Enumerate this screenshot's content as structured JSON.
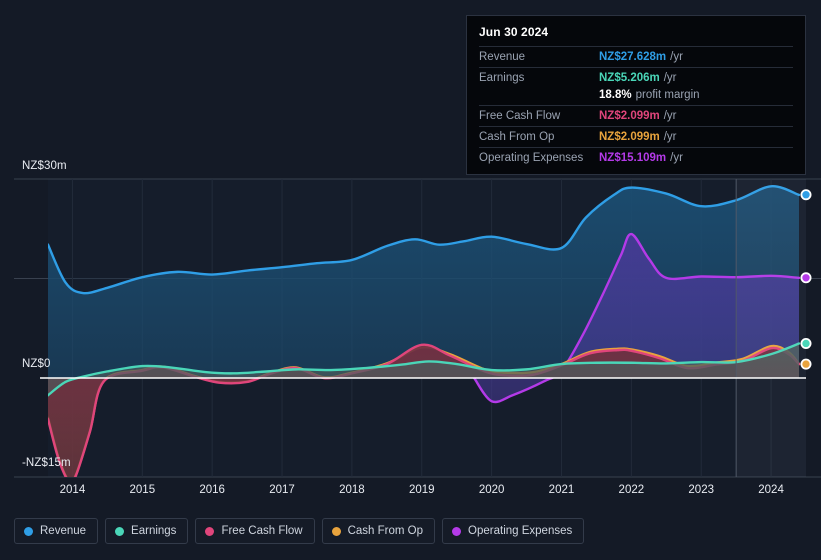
{
  "tooltip": {
    "date": "Jun 30 2024",
    "rows": [
      {
        "label": "Revenue",
        "value": "NZ$27.628m",
        "unit": "/yr",
        "color": "#2f9ee6"
      },
      {
        "label": "Earnings",
        "value": "NZ$5.206m",
        "unit": "/yr",
        "color": "#4ad6b8"
      },
      {
        "label": "",
        "value": "18.8%",
        "unit": "profit margin",
        "color": "#ffffff"
      },
      {
        "label": "Free Cash Flow",
        "value": "NZ$2.099m",
        "unit": "/yr",
        "color": "#e0457b"
      },
      {
        "label": "Cash From Op",
        "value": "NZ$2.099m",
        "unit": "/yr",
        "color": "#e8a33d"
      },
      {
        "label": "Operating Expenses",
        "value": "NZ$15.109m",
        "unit": "/yr",
        "color": "#b43ae8"
      }
    ]
  },
  "legend": {
    "items": [
      {
        "label": "Revenue",
        "color": "#2f9ee6"
      },
      {
        "label": "Earnings",
        "color": "#4ad6b8"
      },
      {
        "label": "Free Cash Flow",
        "color": "#e0457b"
      },
      {
        "label": "Cash From Op",
        "color": "#e8a33d"
      },
      {
        "label": "Operating Expenses",
        "color": "#b43ae8"
      }
    ]
  },
  "chart_data": {
    "type": "area",
    "title": "",
    "xlabel": "",
    "ylabel": "",
    "currency": "NZ$",
    "unit": "m",
    "grid": true,
    "legend_position": "bottom",
    "xlim": [
      2013.65,
      2024.5
    ],
    "ylim": [
      -16.5,
      30.2
    ],
    "y_ticks": [
      {
        "value": 30,
        "label": "NZ$30m"
      },
      {
        "value": 0,
        "label": "NZ$0"
      },
      {
        "value": -15,
        "label": "-NZ$15m"
      }
    ],
    "x_ticks": [
      {
        "value": 2014,
        "label": "2014"
      },
      {
        "value": 2015,
        "label": "2015"
      },
      {
        "value": 2016,
        "label": "2016"
      },
      {
        "value": 2017,
        "label": "2017"
      },
      {
        "value": 2018,
        "label": "2018"
      },
      {
        "value": 2019,
        "label": "2019"
      },
      {
        "value": 2020,
        "label": "2020"
      },
      {
        "value": 2021,
        "label": "2021"
      },
      {
        "value": 2022,
        "label": "2022"
      },
      {
        "value": 2023,
        "label": "2023"
      },
      {
        "value": 2024,
        "label": "2024"
      }
    ],
    "forecast_divider_x": 2023.5,
    "series": [
      {
        "name": "Revenue",
        "color": "#2f9ee6",
        "fill": "#1c4f74",
        "x": [
          2013.65,
          2013.9,
          2014.15,
          2014.5,
          2015.0,
          2015.5,
          2016.0,
          2016.5,
          2017.0,
          2017.5,
          2018.0,
          2018.5,
          2018.9,
          2019.25,
          2019.6,
          2020.0,
          2020.5,
          2021.0,
          2021.35,
          2021.75,
          2022.0,
          2022.5,
          2023.0,
          2023.5,
          2024.0,
          2024.4
        ],
        "y": [
          20.1,
          14.4,
          12.8,
          13.6,
          15.2,
          16.0,
          15.6,
          16.2,
          16.7,
          17.3,
          17.8,
          19.9,
          20.9,
          20.1,
          20.6,
          21.3,
          20.2,
          19.6,
          24.2,
          27.6,
          28.7,
          27.8,
          25.9,
          26.8,
          28.9,
          27.6
        ]
      },
      {
        "name": "Operating Expenses",
        "color": "#b43ae8",
        "fill": "#473a96",
        "x": [
          2019.75,
          2020.0,
          2020.3,
          2020.75,
          2021.0,
          2021.3,
          2021.6,
          2021.85,
          2022.0,
          2022.25,
          2022.5,
          2023.0,
          2023.5,
          2024.0,
          2024.4
        ],
        "y": [
          0.0,
          -3.5,
          -2.6,
          -0.5,
          1.1,
          6.4,
          12.8,
          18.5,
          21.7,
          18.0,
          15.1,
          15.3,
          15.2,
          15.4,
          15.1
        ]
      },
      {
        "name": "Cash From Op",
        "color": "#e8a33d",
        "fill": "#6b4f2e",
        "x": [
          2013.65,
          2013.8,
          2013.95,
          2014.05,
          2014.25,
          2014.45,
          2015.0,
          2015.3,
          2015.75,
          2016.1,
          2016.5,
          2016.85,
          2017.2,
          2017.6,
          2018.0,
          2018.5,
          2019.0,
          2019.4,
          2019.9,
          2020.2,
          2020.6,
          2021.0,
          2021.4,
          2021.8,
          2022.0,
          2022.4,
          2022.8,
          2023.2,
          2023.6,
          2024.0,
          2024.25,
          2024.4
        ],
        "y": [
          -6.0,
          -12.0,
          -15.5,
          -14.6,
          -8.0,
          -0.4,
          1.2,
          1.7,
          0.3,
          -0.6,
          -0.5,
          0.8,
          1.6,
          0.1,
          0.8,
          2.2,
          4.6,
          3.6,
          1.3,
          0.8,
          0.9,
          2.1,
          3.9,
          4.4,
          4.3,
          3.3,
          1.8,
          2.3,
          2.9,
          4.8,
          3.9,
          2.1
        ]
      },
      {
        "name": "Free Cash Flow",
        "color": "#e0457b",
        "fill": "#6e2e45",
        "x": [
          2013.65,
          2013.8,
          2013.95,
          2014.05,
          2014.25,
          2014.45,
          2015.0,
          2015.3,
          2015.75,
          2016.1,
          2016.5,
          2016.85,
          2017.2,
          2017.6,
          2018.0,
          2018.5,
          2019.0,
          2019.4,
          2019.9,
          2020.2,
          2020.6,
          2021.0,
          2021.4,
          2021.8,
          2022.0,
          2022.4,
          2022.8,
          2023.2,
          2023.6,
          2024.0,
          2024.25,
          2024.4
        ],
        "y": [
          -6.2,
          -12.2,
          -15.6,
          -14.7,
          -8.1,
          -0.5,
          1.1,
          1.6,
          0.2,
          -0.7,
          -0.6,
          0.7,
          1.5,
          0.0,
          0.7,
          2.1,
          5.0,
          3.4,
          1.0,
          0.4,
          0.5,
          1.9,
          3.7,
          4.2,
          4.1,
          3.0,
          1.5,
          2.0,
          2.6,
          4.5,
          3.6,
          2.1
        ]
      },
      {
        "name": "Earnings",
        "color": "#4ad6b8",
        "fill": "#4b5c5d",
        "x": [
          2013.65,
          2013.9,
          2014.15,
          2014.5,
          2015.0,
          2015.4,
          2015.9,
          2016.3,
          2016.8,
          2017.2,
          2017.7,
          2018.2,
          2018.7,
          2019.1,
          2019.5,
          2020.0,
          2020.5,
          2021.0,
          2021.5,
          2022.0,
          2022.5,
          2023.0,
          2023.5,
          2024.0,
          2024.4
        ],
        "y": [
          -2.6,
          -0.6,
          0.2,
          1.0,
          1.8,
          1.6,
          0.9,
          0.7,
          1.0,
          1.3,
          1.2,
          1.5,
          2.0,
          2.5,
          2.1,
          1.2,
          1.3,
          2.1,
          2.3,
          2.3,
          2.2,
          2.4,
          2.4,
          3.6,
          5.2
        ]
      }
    ],
    "end_markers": [
      {
        "name": "Revenue",
        "value": 27.628,
        "color": "#2f9ee6"
      },
      {
        "name": "Operating Expenses",
        "value": 15.109,
        "color": "#b43ae8"
      },
      {
        "name": "Earnings",
        "value": 5.206,
        "color": "#4ad6b8"
      },
      {
        "name": "Cash From Op",
        "value": 2.099,
        "color": "#e8a33d"
      }
    ]
  }
}
